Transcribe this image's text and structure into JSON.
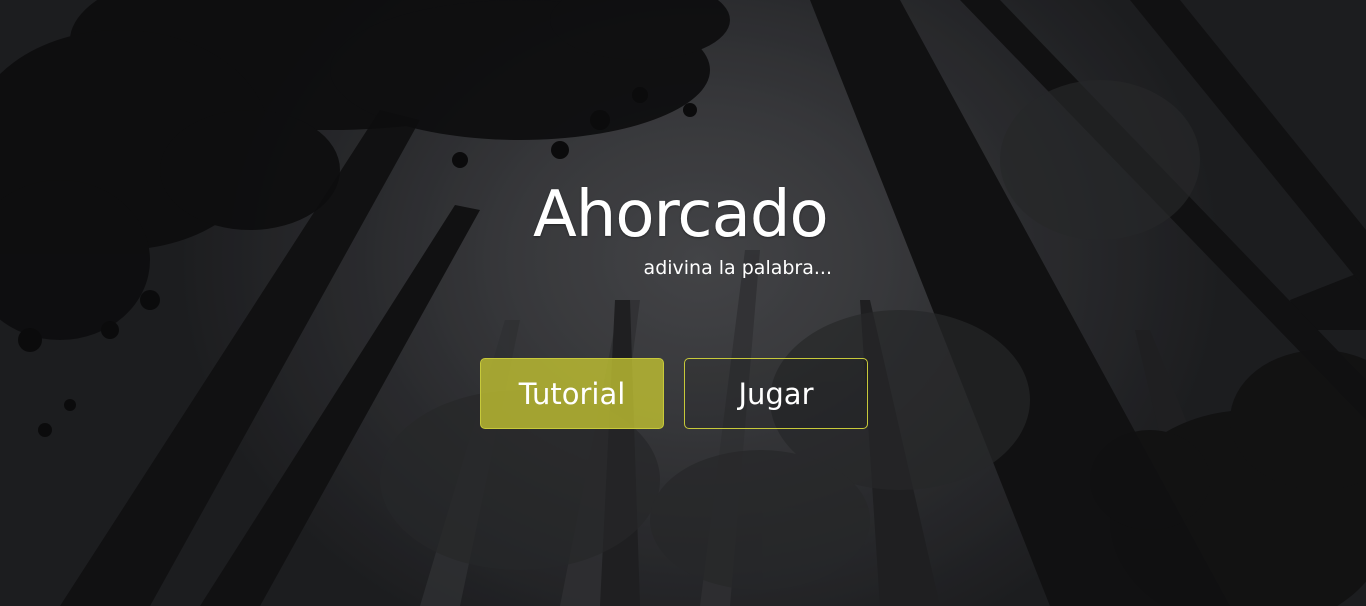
{
  "app": {
    "title": "Ahorcado",
    "subtitle": "adivina la palabra..."
  },
  "buttons": {
    "tutorial_label": "Tutorial",
    "play_label": "Jugar"
  },
  "colors": {
    "accent": "#b5b53a",
    "accent_border": "#c7c93a",
    "text": "#ffffff",
    "background": "#3c3d40"
  }
}
